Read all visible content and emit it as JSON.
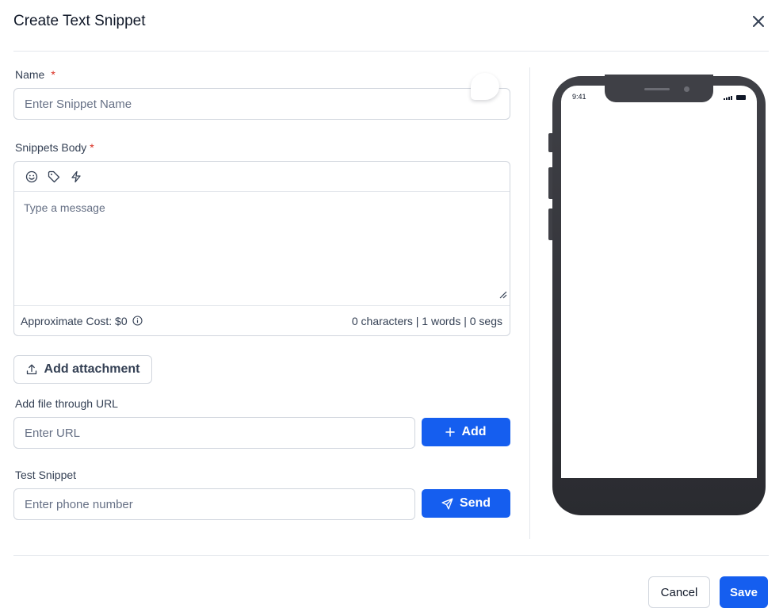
{
  "modal": {
    "title": "Create Text Snippet"
  },
  "name_field": {
    "label": "Name",
    "required_mark": "*",
    "placeholder": "Enter Snippet Name"
  },
  "body_field": {
    "label": "Snippets Body",
    "required_mark": "*",
    "placeholder": "Type a message",
    "toolbar_icons": [
      "emoji-icon",
      "tag-icon",
      "lightning-icon"
    ]
  },
  "stats": {
    "cost": "Approximate Cost: $0",
    "counts": "0 characters | 1 words | 0 segs"
  },
  "attachment": {
    "button_label": "Add attachment"
  },
  "url_field": {
    "label": "Add file through URL",
    "placeholder": "Enter URL",
    "add_label": "Add"
  },
  "test_snippet": {
    "label": "Test Snippet",
    "placeholder": "Enter phone number",
    "send_label": "Send"
  },
  "footer": {
    "cancel_label": "Cancel",
    "save_label": "Save"
  },
  "phone_preview": {
    "time": "9:41"
  },
  "colors": {
    "primary": "#155eef",
    "required": "#d92d20",
    "border": "#d0d5dd",
    "phone_frame": "#3f4046"
  }
}
